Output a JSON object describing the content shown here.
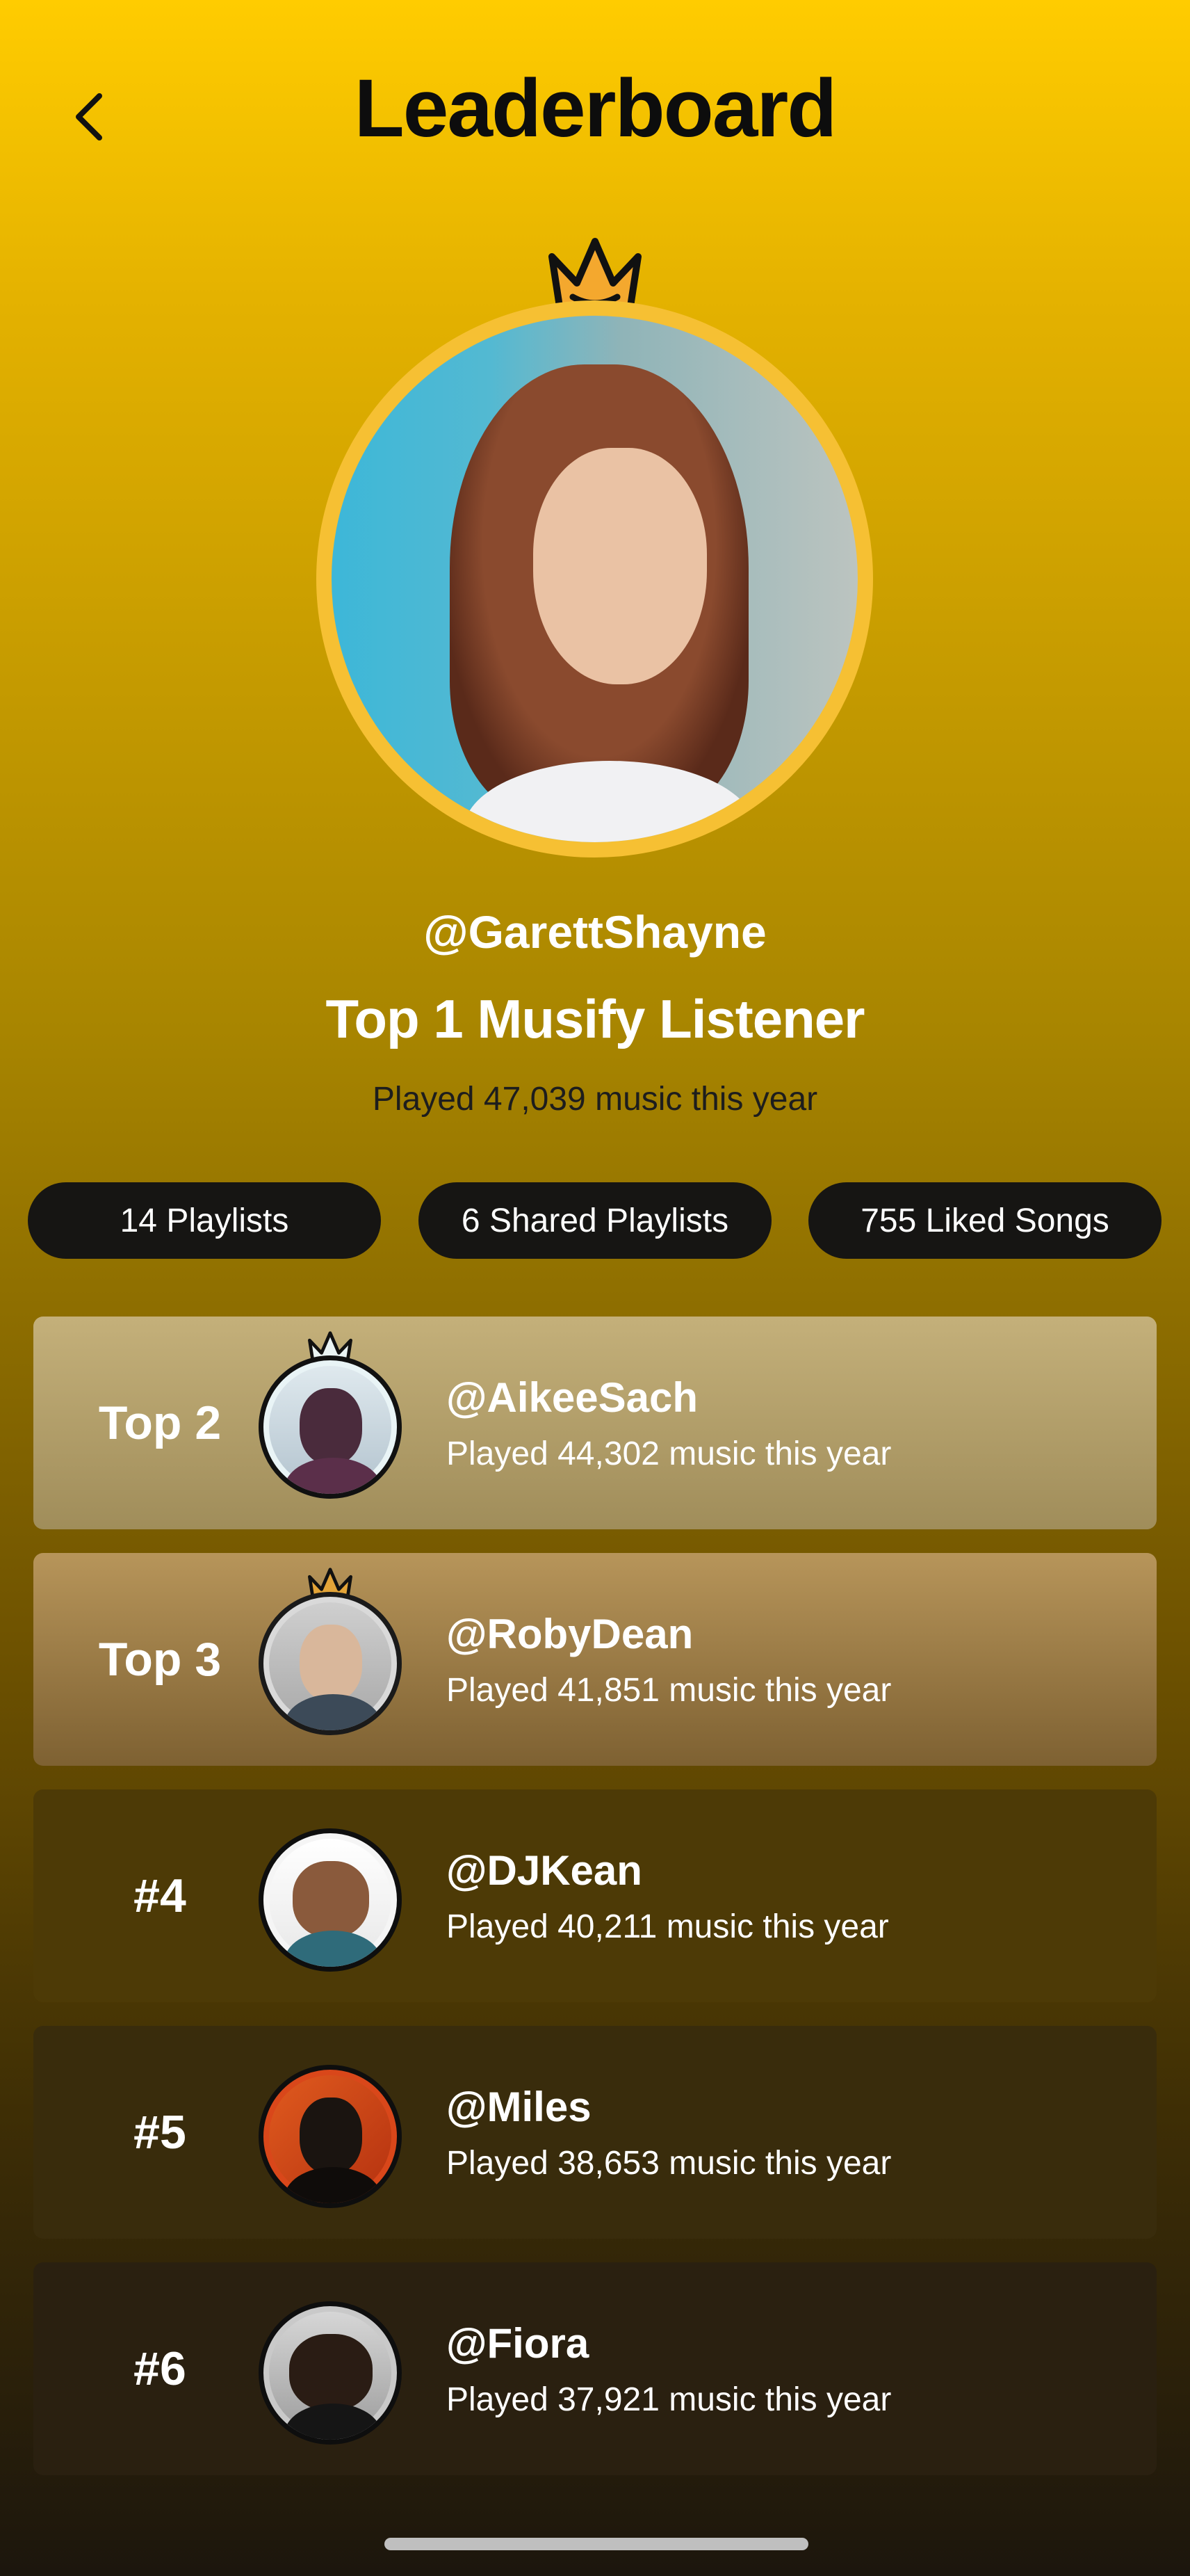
{
  "header": {
    "title": "Leaderboard",
    "back_icon": "chevron-left-icon"
  },
  "top_user": {
    "username": "@GarettShayne",
    "title": "Top 1 Musify Listener",
    "played": "Played 47,039 music this year",
    "crown_icon": "crown-icon"
  },
  "stats": [
    {
      "label": "14 Playlists"
    },
    {
      "label": "6 Shared Playlists"
    },
    {
      "label": "755 Liked Songs"
    }
  ],
  "leaderboard": [
    {
      "rank": "Top 2",
      "name": "@AikeeSach",
      "played": "Played 44,302 music this year"
    },
    {
      "rank": "Top 3",
      "name": "@RobyDean",
      "played": "Played 41,851 music this year"
    },
    {
      "rank": "#4",
      "name": "@DJKean",
      "played": "Played 40,211 music this year"
    },
    {
      "rank": "#5",
      "name": "@Miles",
      "played": "Played 38,653 music this year"
    },
    {
      "rank": "#6",
      "name": "@Fiora",
      "played": "Played 37,921 music this year"
    }
  ],
  "colors": {
    "accent": "#FFCC00",
    "crown_gold": "#F4A82E",
    "crown_silver": "#EAF4F4",
    "pill_bg": "#161513"
  }
}
